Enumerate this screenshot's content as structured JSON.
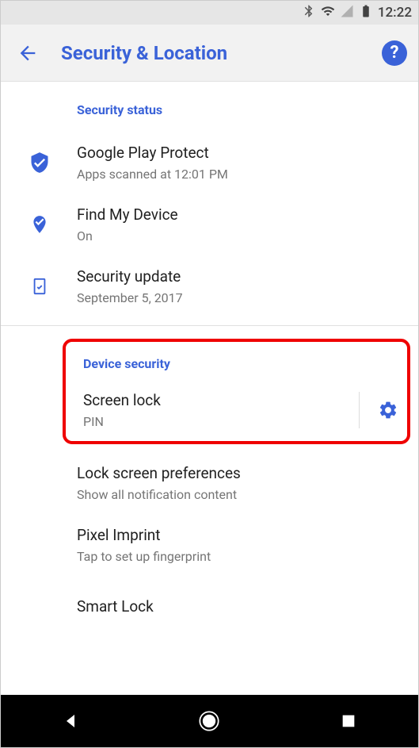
{
  "statusBar": {
    "time": "12:22"
  },
  "appBar": {
    "title": "Security & Location"
  },
  "sections": {
    "securityStatus": {
      "header": "Security status",
      "playProtect": {
        "title": "Google Play Protect",
        "subtitle": "Apps scanned at 12:01 PM"
      },
      "findMyDevice": {
        "title": "Find My Device",
        "subtitle": "On"
      },
      "securityUpdate": {
        "title": "Security update",
        "subtitle": "September 5, 2017"
      }
    },
    "deviceSecurity": {
      "header": "Device security",
      "screenLock": {
        "title": "Screen lock",
        "subtitle": "PIN"
      },
      "lockScreenPrefs": {
        "title": "Lock screen preferences",
        "subtitle": "Show all notification content"
      },
      "pixelImprint": {
        "title": "Pixel Imprint",
        "subtitle": "Tap to set up fingerprint"
      },
      "smartLock": {
        "title": "Smart Lock"
      }
    }
  }
}
